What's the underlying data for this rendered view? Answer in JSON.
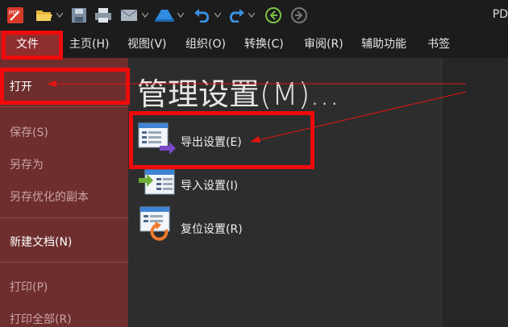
{
  "toolbar": {
    "app_title": "PD",
    "icons": [
      "pdf-logo-icon",
      "open-folder-icon",
      "save-icon",
      "print-icon",
      "email-icon",
      "upload-icon",
      "undo-icon",
      "redo-icon",
      "back-icon",
      "forward-icon"
    ]
  },
  "menubar": {
    "file": "文件",
    "items": [
      "主页(H)",
      "视图(V)",
      "组织(O)",
      "转换(C)",
      "审阅(R)",
      "辅助功能",
      "书签"
    ]
  },
  "sidebar": {
    "open": "打开",
    "save": "保存(S)",
    "save_as": "另存为",
    "save_optimized": "另存优化的副本",
    "new_doc": "新建文档(N)",
    "print": "打印(P)",
    "print_all": "打印全部(R)"
  },
  "main": {
    "title": "管理设置(M)...",
    "export": "导出设置(E)",
    "import": "导入设置(I)",
    "reset": "复位设置(R)"
  },
  "colors": {
    "accent_red": "#f00a0a",
    "sidebar": "#6e2e2e",
    "file_tab": "#8f2e2e"
  }
}
